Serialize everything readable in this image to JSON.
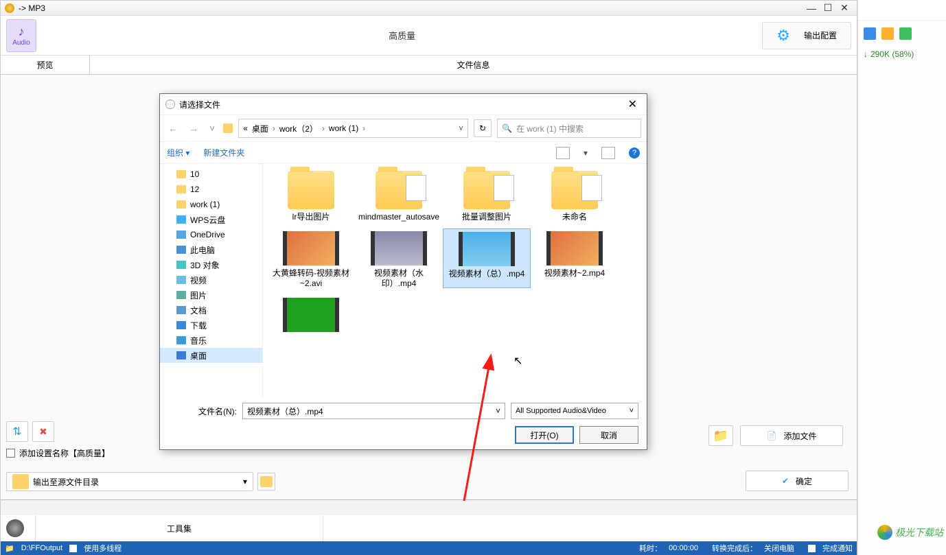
{
  "window": {
    "title": "-> MP3"
  },
  "toolbar": {
    "audio_label": "Audio",
    "center_label": "高质量",
    "output_config": "输出配置"
  },
  "tabs": {
    "preview": "预览",
    "file_info": "文件信息"
  },
  "footer": {
    "add_setting": "添加设置名称【高质量】",
    "output_combo": "输出至源文件目录",
    "add_file": "添加文件",
    "confirm": "确定"
  },
  "tray": {
    "tools": "工具集",
    "path": "D:\\FFOutput",
    "use_mt": "使用多线程",
    "elapsed_lbl": "耗时：",
    "elapsed_val": "00:00:00",
    "after_lbl": "转换完成后：",
    "after_val": "关闭电脑",
    "done_notify": "完成通知"
  },
  "right": {
    "dl": "290K (58%)"
  },
  "dialog": {
    "title": "请选择文件",
    "crumbs": [
      "«",
      "桌面",
      "›",
      "work（2）",
      "›",
      "work (1)",
      "›"
    ],
    "search_placeholder": "在 work (1) 中搜索",
    "org": "组织 ▾",
    "newf": "新建文件夹",
    "tree": [
      {
        "label": "10",
        "ico": "ti-ico"
      },
      {
        "label": "12",
        "ico": "ti-ico"
      },
      {
        "label": "work (1)",
        "ico": "ti-ico"
      },
      {
        "label": "WPS云盘",
        "ico": "ti-ico cloud"
      },
      {
        "label": "OneDrive",
        "ico": "ti-ico drive"
      },
      {
        "label": "此电脑",
        "ico": "ti-ico pc"
      },
      {
        "label": "3D 对象",
        "ico": "ti-ico cube"
      },
      {
        "label": "视频",
        "ico": "ti-ico vid"
      },
      {
        "label": "图片",
        "ico": "ti-ico pic"
      },
      {
        "label": "文档",
        "ico": "ti-ico doc"
      },
      {
        "label": "下载",
        "ico": "ti-ico dl"
      },
      {
        "label": "音乐",
        "ico": "ti-ico mus"
      },
      {
        "label": "桌面",
        "ico": "ti-ico desk",
        "sel": true
      }
    ],
    "files_row1": [
      {
        "name": "lr导出图片",
        "type": "folder"
      },
      {
        "name": "mindmaster_autosave",
        "type": "folder-sheet"
      },
      {
        "name": "批量调整图片",
        "type": "folder-sheet"
      },
      {
        "name": "未命名",
        "type": "folder-sheet"
      }
    ],
    "files_row2": [
      {
        "name": "大黄蜂转码-视频素材~2.avi",
        "type": "vid",
        "cls": "vt1"
      },
      {
        "name": "视频素材（水印）.mp4",
        "type": "vid",
        "cls": "vt2"
      },
      {
        "name": "视频素材（总）.mp4",
        "type": "vid",
        "cls": "vt3",
        "sel": true
      },
      {
        "name": "视频素材~2.mp4",
        "type": "vid",
        "cls": "vt1"
      }
    ],
    "files_row3": [
      {
        "name": "",
        "type": "vid",
        "cls": "vt4"
      }
    ],
    "filename_label": "文件名(N):",
    "filename_value": "视频素材（总）.mp4",
    "filter": "All Supported Audio&Video",
    "open": "打开(O)",
    "cancel": "取消"
  },
  "watermark": "极光下载站"
}
